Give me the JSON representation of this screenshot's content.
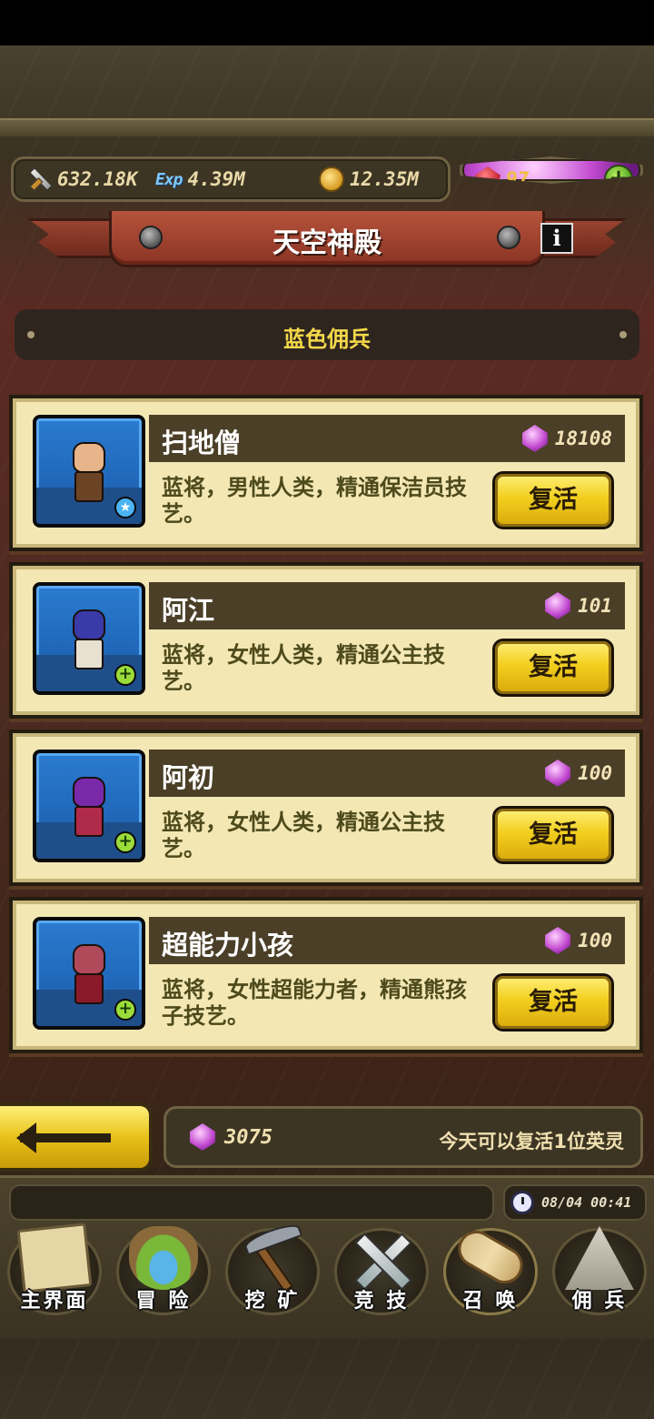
{
  "resources": {
    "attack": "632.18K",
    "exp_icon": "Exp",
    "exp": "4.39M",
    "gold": "12.35M",
    "rubies": "97"
  },
  "header": {
    "title": "天空神殿",
    "info_label": "i"
  },
  "category": {
    "label": "蓝色佣兵"
  },
  "mercenaries": [
    {
      "name": "扫地僧",
      "cost": "18108",
      "description": "蓝将，男性人类，精通保洁员技艺。",
      "button": "复活",
      "badge": "★"
    },
    {
      "name": "阿江",
      "cost": "101",
      "description": "蓝将，女性人类，精通公主技艺。",
      "button": "复活",
      "badge": "+"
    },
    {
      "name": "阿初",
      "cost": "100",
      "description": "蓝将，女性人类，精通公主技艺。",
      "button": "复活",
      "badge": "+"
    },
    {
      "name": "超能力小孩",
      "cost": "100",
      "description": "蓝将，女性超能力者，精通熊孩子技艺。",
      "button": "复活",
      "badge": "+"
    }
  ],
  "footer_info": {
    "gems": "3075",
    "note": "今天可以复活1位英灵"
  },
  "clock": {
    "datetime": "08/04 00:41"
  },
  "nav": [
    {
      "label": "主界面",
      "icon": "map-scroll-icon"
    },
    {
      "label": "冒 险",
      "icon": "floating-island-icon"
    },
    {
      "label": "挖 矿",
      "icon": "pickaxe-icon"
    },
    {
      "label": "竞 技",
      "icon": "crossed-swords-icon"
    },
    {
      "label": "召 唤",
      "icon": "summon-scroll-icon"
    },
    {
      "label": "佣 兵",
      "icon": "tent-icon"
    }
  ],
  "colors": {
    "button_yellow": "#f2cf1e",
    "card_bg": "#f3e7b4",
    "banner_red": "#b6533c",
    "category_text": "#f4d94a",
    "portrait_blue": "#2a7bd0"
  }
}
